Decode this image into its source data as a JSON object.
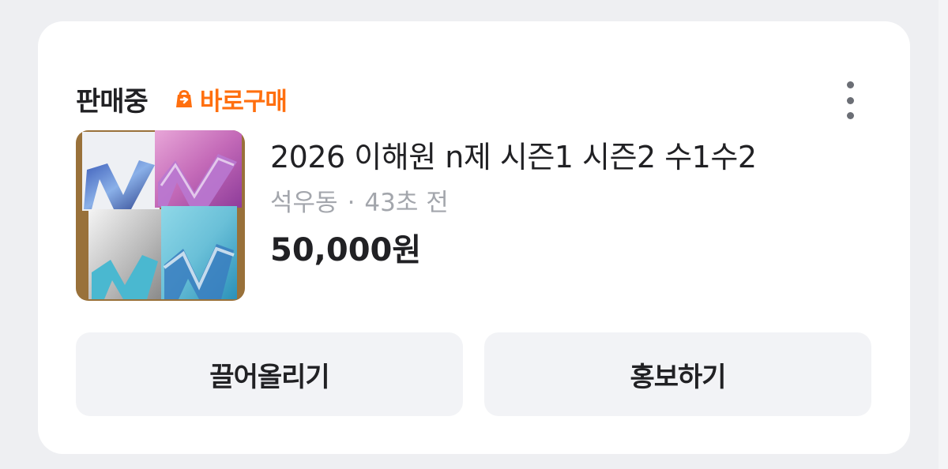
{
  "header": {
    "status": "판매중",
    "badge_label": "바로구매",
    "badge_icon": "direct-buy-icon",
    "more_icon": "more-vertical-icon"
  },
  "product": {
    "title": "2026 이해원 n제 시즌1 시즌2 수1수2",
    "location": "석우동",
    "separator": "·",
    "time_ago": "43초 전",
    "price": "50,000원",
    "thumbnail_icon": "product-thumbnail"
  },
  "actions": {
    "bump_label": "끌어올리기",
    "promote_label": "홍보하기"
  },
  "colors": {
    "accent": "#ff6f0f",
    "text_primary": "#212124",
    "text_secondary": "#a3a6ac",
    "button_bg": "#f2f3f6"
  }
}
